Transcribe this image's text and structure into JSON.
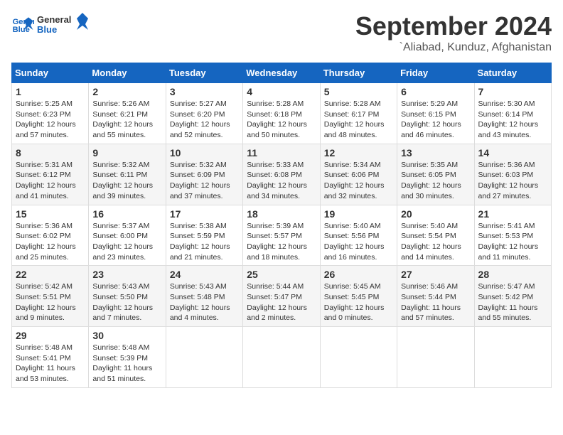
{
  "logo": {
    "line1": "General",
    "line2": "Blue"
  },
  "title": "September 2024",
  "subtitle": "`Aliabad, Kunduz, Afghanistan",
  "days_of_week": [
    "Sunday",
    "Monday",
    "Tuesday",
    "Wednesday",
    "Thursday",
    "Friday",
    "Saturday"
  ],
  "weeks": [
    [
      {
        "day": "1",
        "sunrise": "5:25 AM",
        "sunset": "6:23 PM",
        "daylight": "12 hours and 57 minutes."
      },
      {
        "day": "2",
        "sunrise": "5:26 AM",
        "sunset": "6:21 PM",
        "daylight": "12 hours and 55 minutes."
      },
      {
        "day": "3",
        "sunrise": "5:27 AM",
        "sunset": "6:20 PM",
        "daylight": "12 hours and 52 minutes."
      },
      {
        "day": "4",
        "sunrise": "5:28 AM",
        "sunset": "6:18 PM",
        "daylight": "12 hours and 50 minutes."
      },
      {
        "day": "5",
        "sunrise": "5:28 AM",
        "sunset": "6:17 PM",
        "daylight": "12 hours and 48 minutes."
      },
      {
        "day": "6",
        "sunrise": "5:29 AM",
        "sunset": "6:15 PM",
        "daylight": "12 hours and 46 minutes."
      },
      {
        "day": "7",
        "sunrise": "5:30 AM",
        "sunset": "6:14 PM",
        "daylight": "12 hours and 43 minutes."
      }
    ],
    [
      {
        "day": "8",
        "sunrise": "5:31 AM",
        "sunset": "6:12 PM",
        "daylight": "12 hours and 41 minutes."
      },
      {
        "day": "9",
        "sunrise": "5:32 AM",
        "sunset": "6:11 PM",
        "daylight": "12 hours and 39 minutes."
      },
      {
        "day": "10",
        "sunrise": "5:32 AM",
        "sunset": "6:09 PM",
        "daylight": "12 hours and 37 minutes."
      },
      {
        "day": "11",
        "sunrise": "5:33 AM",
        "sunset": "6:08 PM",
        "daylight": "12 hours and 34 minutes."
      },
      {
        "day": "12",
        "sunrise": "5:34 AM",
        "sunset": "6:06 PM",
        "daylight": "12 hours and 32 minutes."
      },
      {
        "day": "13",
        "sunrise": "5:35 AM",
        "sunset": "6:05 PM",
        "daylight": "12 hours and 30 minutes."
      },
      {
        "day": "14",
        "sunrise": "5:36 AM",
        "sunset": "6:03 PM",
        "daylight": "12 hours and 27 minutes."
      }
    ],
    [
      {
        "day": "15",
        "sunrise": "5:36 AM",
        "sunset": "6:02 PM",
        "daylight": "12 hours and 25 minutes."
      },
      {
        "day": "16",
        "sunrise": "5:37 AM",
        "sunset": "6:00 PM",
        "daylight": "12 hours and 23 minutes."
      },
      {
        "day": "17",
        "sunrise": "5:38 AM",
        "sunset": "5:59 PM",
        "daylight": "12 hours and 21 minutes."
      },
      {
        "day": "18",
        "sunrise": "5:39 AM",
        "sunset": "5:57 PM",
        "daylight": "12 hours and 18 minutes."
      },
      {
        "day": "19",
        "sunrise": "5:40 AM",
        "sunset": "5:56 PM",
        "daylight": "12 hours and 16 minutes."
      },
      {
        "day": "20",
        "sunrise": "5:40 AM",
        "sunset": "5:54 PM",
        "daylight": "12 hours and 14 minutes."
      },
      {
        "day": "21",
        "sunrise": "5:41 AM",
        "sunset": "5:53 PM",
        "daylight": "12 hours and 11 minutes."
      }
    ],
    [
      {
        "day": "22",
        "sunrise": "5:42 AM",
        "sunset": "5:51 PM",
        "daylight": "12 hours and 9 minutes."
      },
      {
        "day": "23",
        "sunrise": "5:43 AM",
        "sunset": "5:50 PM",
        "daylight": "12 hours and 7 minutes."
      },
      {
        "day": "24",
        "sunrise": "5:43 AM",
        "sunset": "5:48 PM",
        "daylight": "12 hours and 4 minutes."
      },
      {
        "day": "25",
        "sunrise": "5:44 AM",
        "sunset": "5:47 PM",
        "daylight": "12 hours and 2 minutes."
      },
      {
        "day": "26",
        "sunrise": "5:45 AM",
        "sunset": "5:45 PM",
        "daylight": "12 hours and 0 minutes."
      },
      {
        "day": "27",
        "sunrise": "5:46 AM",
        "sunset": "5:44 PM",
        "daylight": "11 hours and 57 minutes."
      },
      {
        "day": "28",
        "sunrise": "5:47 AM",
        "sunset": "5:42 PM",
        "daylight": "11 hours and 55 minutes."
      }
    ],
    [
      {
        "day": "29",
        "sunrise": "5:48 AM",
        "sunset": "5:41 PM",
        "daylight": "11 hours and 53 minutes."
      },
      {
        "day": "30",
        "sunrise": "5:48 AM",
        "sunset": "5:39 PM",
        "daylight": "11 hours and 51 minutes."
      },
      null,
      null,
      null,
      null,
      null
    ]
  ]
}
